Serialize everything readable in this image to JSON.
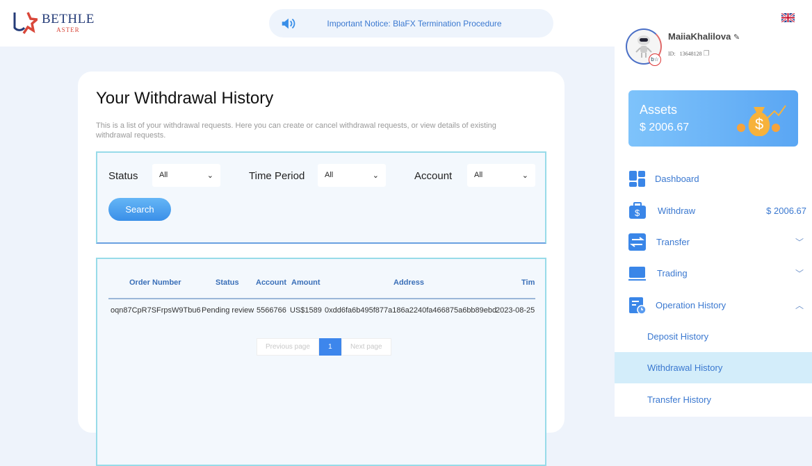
{
  "logo": {
    "name": "BETHLE",
    "sub": "ASTER"
  },
  "notice": "Important Notice: BlaFX Termination Procedure",
  "page": {
    "title": "Your Withdrawal History",
    "description": "This is a list of your withdrawal requests. Here you can create or cancel withdrawal requests, or view details of existing withdrawal requests."
  },
  "filters": {
    "status_label": "Status",
    "status_value": "All",
    "period_label": "Time Period",
    "period_value": "All",
    "account_label": "Account",
    "account_value": "All",
    "search": "Search"
  },
  "table": {
    "headers": [
      "Order Number",
      "Status",
      "Account",
      "Amount",
      "Address",
      "Tim"
    ],
    "rows": [
      [
        "oqn87CpR7SFrpsW9Tbu6",
        "Pending review",
        "5566766",
        "US$1589",
        "0xdd6fa6b495f877a186a2240fa466875a6bb89ebd",
        "2023-08-25"
      ]
    ]
  },
  "pager": {
    "prev": "Previous page",
    "current": "1",
    "next": "Next page"
  },
  "user": {
    "name": "MaiiaKhalilova",
    "id_label": "ID:",
    "id": "13648128"
  },
  "assets": {
    "label": "Assets",
    "value": "$ 2006.67"
  },
  "nav": {
    "dashboard": "Dashboard",
    "withdraw": "Withdraw",
    "withdraw_amount": "$ 2006.67",
    "transfer": "Transfer",
    "trading": "Trading",
    "history": "Operation History",
    "sub": [
      "Deposit History",
      "Withdrawal History",
      "Transfer History"
    ]
  }
}
